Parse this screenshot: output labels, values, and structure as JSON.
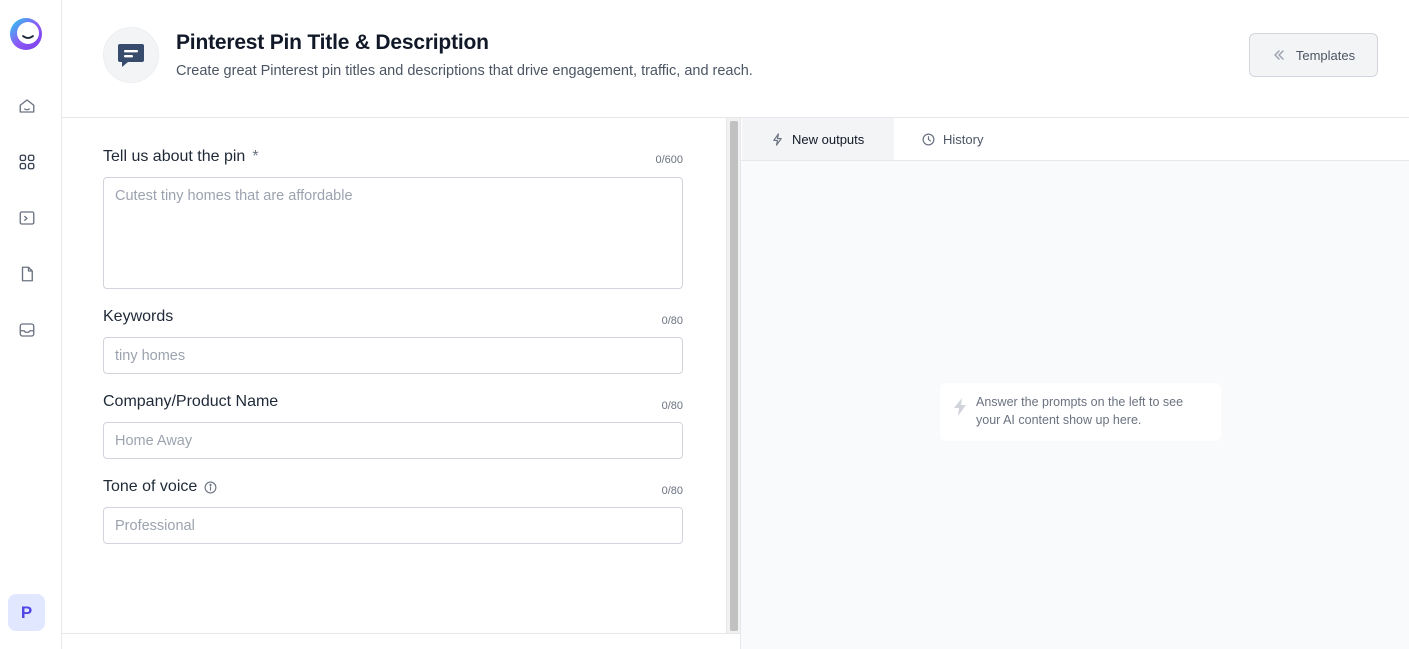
{
  "sidebar": {
    "nav": [
      {
        "icon": "home-icon"
      },
      {
        "icon": "grid-icon"
      },
      {
        "icon": "terminal-icon"
      },
      {
        "icon": "document-icon"
      },
      {
        "icon": "inbox-icon"
      }
    ],
    "avatar_initial": "P"
  },
  "header": {
    "title": "Pinterest Pin Title & Description",
    "subtitle": "Create great Pinterest pin titles and descriptions that drive engagement, traffic, and reach.",
    "templates_label": "Templates"
  },
  "form": {
    "about_pin": {
      "label": "Tell us about the pin",
      "required_mark": "*",
      "counter": "0/600",
      "placeholder": "Cutest tiny homes that are affordable"
    },
    "keywords": {
      "label": "Keywords",
      "counter": "0/80",
      "placeholder": "tiny homes"
    },
    "company": {
      "label": "Company/Product Name",
      "counter": "0/80",
      "placeholder": "Home Away"
    },
    "tone": {
      "label": "Tone of voice",
      "counter": "0/80",
      "placeholder": "Professional"
    }
  },
  "outputs": {
    "tab_new": "New outputs",
    "tab_history": "History",
    "empty_message": "Answer the prompts on the left to see your AI content show up here."
  },
  "colors": {
    "accent": "#4f46e5",
    "logo": "#7c3aed",
    "icon": "#374b6c"
  }
}
